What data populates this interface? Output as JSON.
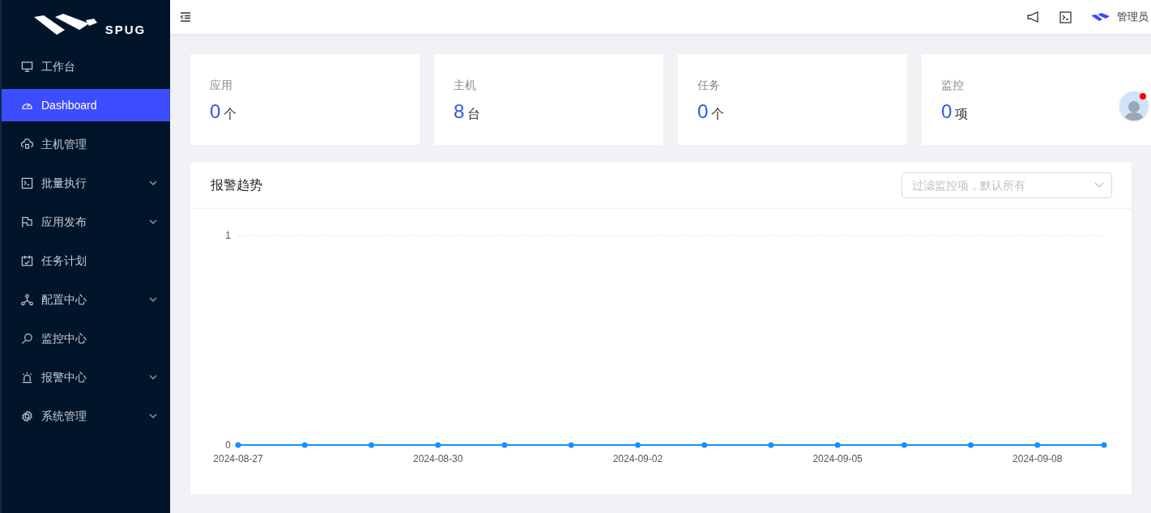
{
  "sidebar": {
    "logo_text": "SPUG",
    "items": [
      {
        "label": "工作台",
        "selected": false,
        "expandable": false
      },
      {
        "label": "Dashboard",
        "selected": true,
        "expandable": false
      },
      {
        "label": "主机管理",
        "selected": false,
        "expandable": false
      },
      {
        "label": "批量执行",
        "selected": false,
        "expandable": true
      },
      {
        "label": "应用发布",
        "selected": false,
        "expandable": true
      },
      {
        "label": "任务计划",
        "selected": false,
        "expandable": false
      },
      {
        "label": "配置中心",
        "selected": false,
        "expandable": true
      },
      {
        "label": "监控中心",
        "selected": false,
        "expandable": false
      },
      {
        "label": "报警中心",
        "selected": false,
        "expandable": true
      },
      {
        "label": "系统管理",
        "selected": false,
        "expandable": true
      }
    ]
  },
  "header": {
    "user": "管理员"
  },
  "stats": [
    {
      "label": "应用",
      "value": "0",
      "unit": "个"
    },
    {
      "label": "主机",
      "value": "8",
      "unit": "台"
    },
    {
      "label": "任务",
      "value": "0",
      "unit": "个"
    },
    {
      "label": "监控",
      "value": "0",
      "unit": "项"
    }
  ],
  "alarm_trend": {
    "title": "报警趋势",
    "filter": {
      "placeholder": "过滤监控项，默认所有"
    },
    "chart_data": {
      "type": "line",
      "categories": [
        "2024-08-27",
        null,
        null,
        "2024-08-30",
        null,
        null,
        "2024-09-02",
        null,
        null,
        "2024-09-05",
        null,
        null,
        "2024-09-08",
        null
      ],
      "series": [
        {
          "color": "#1890ff",
          "marker": "circle",
          "values": [
            0,
            0,
            0,
            0,
            0,
            0,
            0,
            0,
            0,
            0,
            0,
            0,
            0,
            0
          ]
        }
      ],
      "ylim": [
        0,
        1
      ],
      "yticks": [
        0,
        1
      ]
    }
  }
}
